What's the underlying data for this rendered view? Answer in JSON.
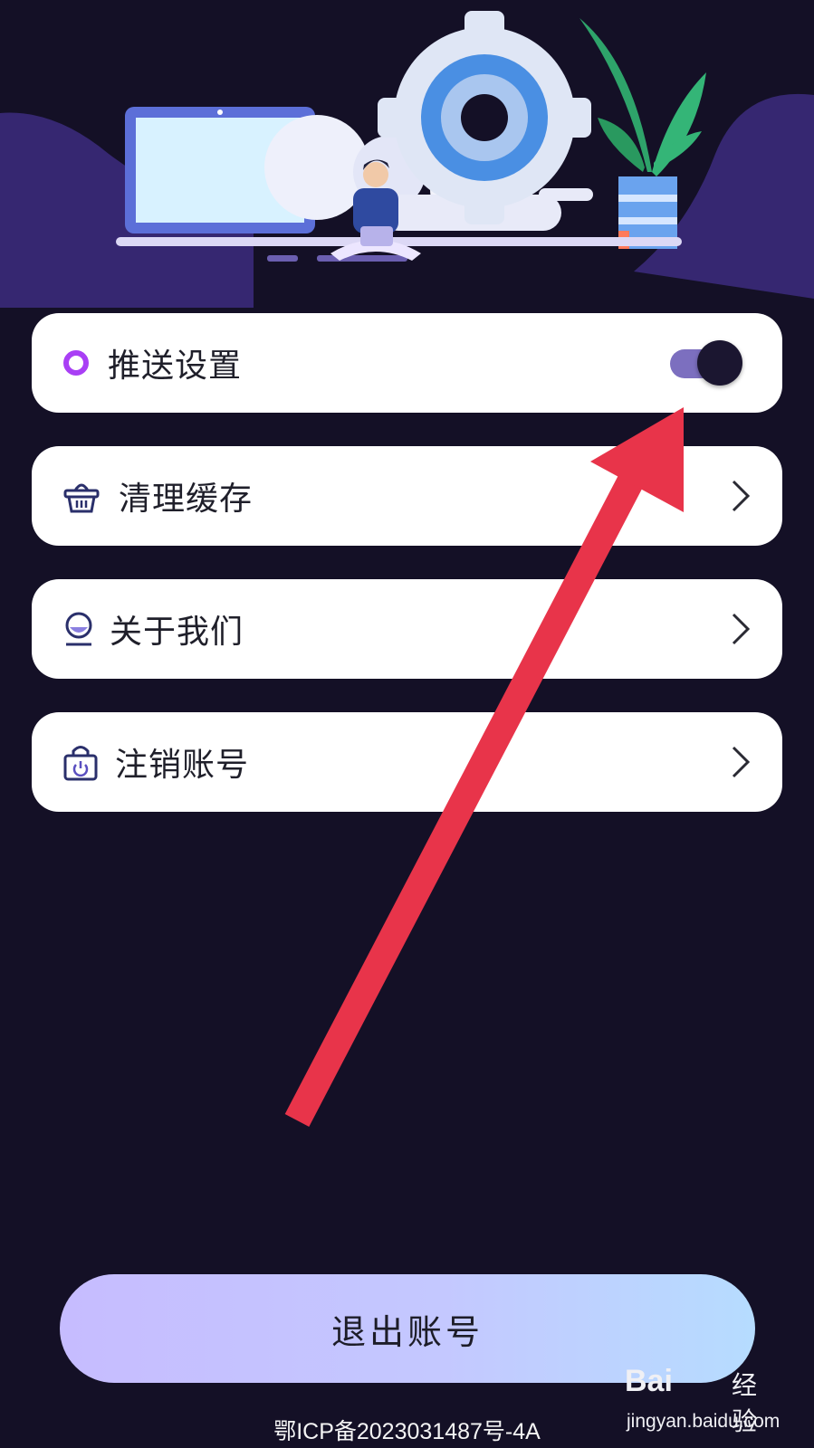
{
  "settings": {
    "items": [
      {
        "label": "推送设置",
        "icon": "radio-ring-icon",
        "control": "toggle",
        "toggle_on": true
      },
      {
        "label": "清理缓存",
        "icon": "basket-icon",
        "control": "chevron"
      },
      {
        "label": "关于我们",
        "icon": "profile-badge-icon",
        "control": "chevron"
      },
      {
        "label": "注销账号",
        "icon": "lock-power-icon",
        "control": "chevron"
      }
    ]
  },
  "logout_button": {
    "label": "退出账号"
  },
  "footer": {
    "icp": "鄂ICP备2023031487号-4A"
  },
  "watermark": {
    "brand": "Bai",
    "brand_cn": "经验",
    "url": "jingyan.baidu.com"
  },
  "colors": {
    "background": "#141026",
    "card": "#ffffff",
    "toggle_track": "#7c6fbf",
    "toggle_knob": "#1b1630",
    "annotation_arrow": "#e8344a",
    "accent_purple": "#a93ff5"
  }
}
